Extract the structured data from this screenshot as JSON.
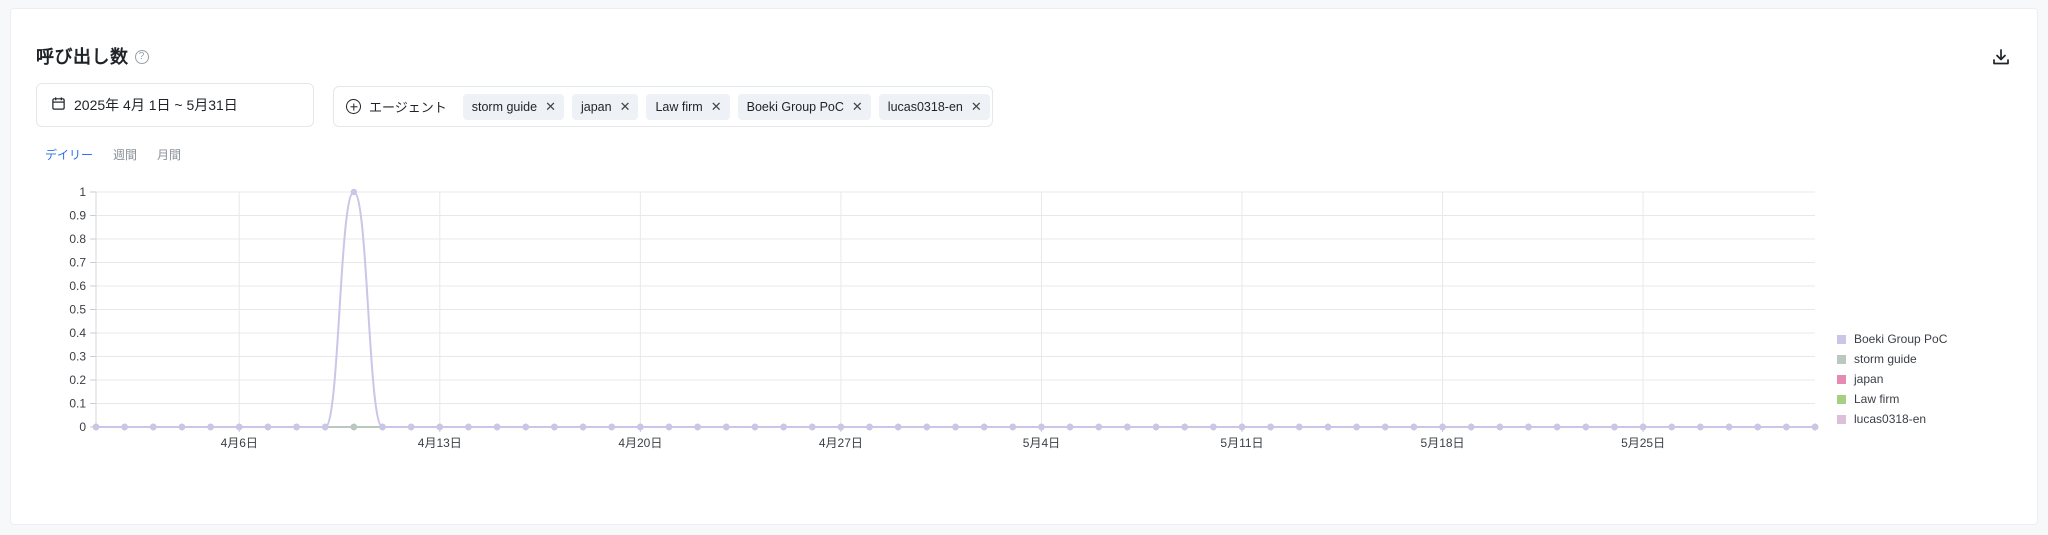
{
  "header": {
    "title": "呼び出し数",
    "help_icon": "question-circle-icon",
    "download_icon": "download-icon"
  },
  "filters": {
    "date_range": "2025年 4月 1日 ~ 5月31日",
    "calendar_icon": "calendar-icon",
    "agent_label": "エージェント",
    "chips": [
      {
        "label": "storm guide"
      },
      {
        "label": "japan"
      },
      {
        "label": "Law firm"
      },
      {
        "label": "Boeki Group PoC"
      },
      {
        "label": "lucas0318-en"
      }
    ],
    "chip_close": "✕"
  },
  "tabs": [
    {
      "label": "デイリー",
      "active": true
    },
    {
      "label": "週間",
      "active": false
    },
    {
      "label": "月間",
      "active": false
    }
  ],
  "chart_data": {
    "type": "line",
    "x_start": "2025-04-01",
    "x_end": "2025-05-31",
    "x_ticks": [
      "4月6日",
      "4月13日",
      "4月20日",
      "4月27日",
      "5月4日",
      "5月11日",
      "5月18日",
      "5月25日"
    ],
    "y_ticks": [
      "1",
      "0.9",
      "0.8",
      "0.7",
      "0.6",
      "0.5",
      "0.4",
      "0.3",
      "0.2",
      "0.1",
      "0"
    ],
    "ylim": [
      0,
      1
    ],
    "legend_position": "right",
    "series": [
      {
        "name": "Boeki Group PoC",
        "color": "#c9c6e8",
        "points": [
          {
            "x": "2025-04-10",
            "y": 1
          }
        ]
      },
      {
        "name": "storm guide",
        "color": "#b9c9c0",
        "points": []
      },
      {
        "name": "japan",
        "color": "#e58ab0",
        "points": []
      },
      {
        "name": "Law firm",
        "color": "#a7cf82",
        "points": []
      },
      {
        "name": "lucas0318-en",
        "color": "#dcc0d9",
        "points": []
      }
    ]
  }
}
